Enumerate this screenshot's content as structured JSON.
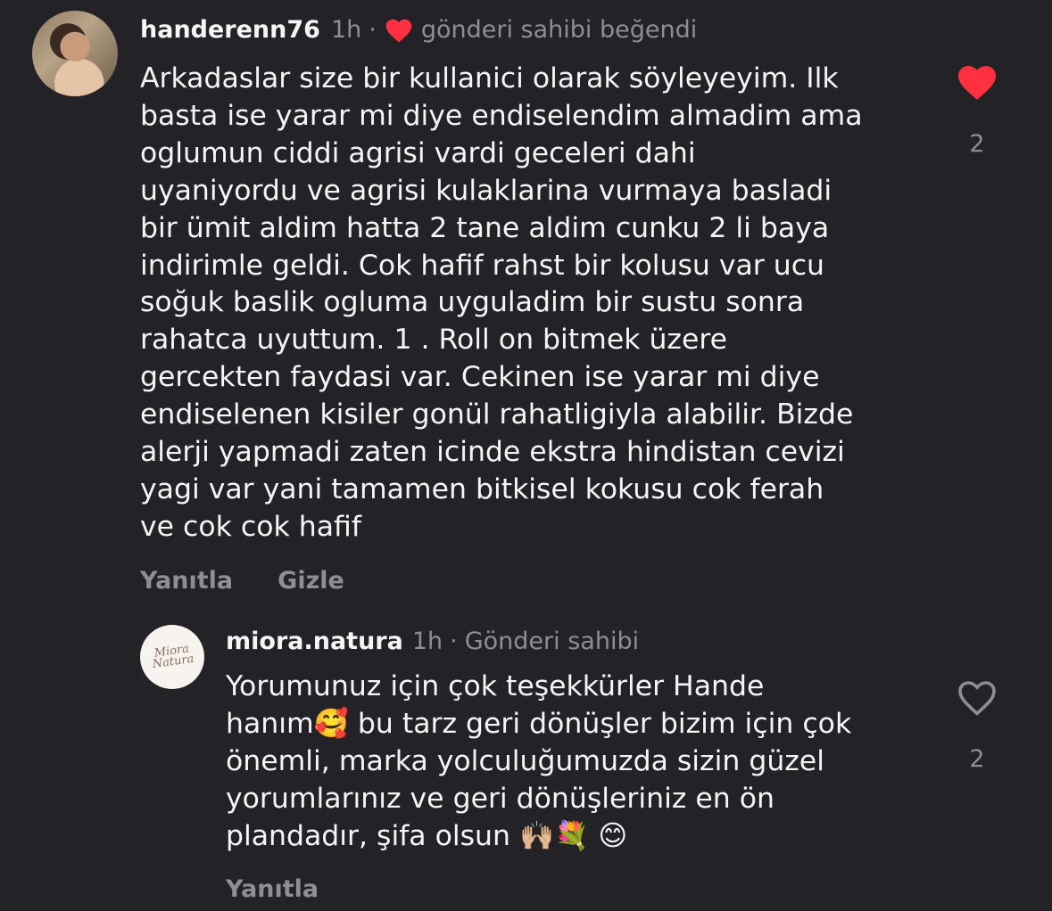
{
  "comments": [
    {
      "username": "handerenn76",
      "time": "1h",
      "author_liked_label": "gönderi sahibi beğendi",
      "lines": [
        "Arkadaslar size bir kullanici olarak söyleyeyim. Ilk",
        "basta ise yarar mi diye endiselendim almadim ama",
        "oglumun ciddi agrisi vardi geceleri dahi",
        "uyaniyordu ve agrisi kulaklarina vurmaya basladi",
        "bir ümit aldim hatta 2 tane aldim cunku 2 li baya",
        "indirimle geldi. Cok hafif rahst bir kolusu var ucu",
        "soğuk baslik ogluma uyguladim bir sustu sonra",
        "rahatca uyuttum. 1 . Roll on bitmek üzere",
        "gercekten faydasi var. Cekinen ise yarar mi diye",
        "endiselenen kisiler gonül rahatligiyla alabilir. Bizde",
        "alerji yapmadi zaten icinde ekstra hindistan cevizi",
        "yagi var yani tamamen bitkisel kokusu cok ferah",
        "ve cok cok hafif"
      ],
      "actions": [
        "Yanıtla",
        "Gizle"
      ],
      "like_count": "2",
      "liked": true
    },
    {
      "username": "miora.natura",
      "time": "1h",
      "badge": "Gönderi sahibi",
      "avatar_text": "Miora Natura",
      "lines": [
        "Yorumunuz için çok teşekkürler Hande",
        "hanım🥰 bu tarz geri dönüşler bizim için çok",
        "önemli, marka yolculuğumuzda sizin güzel",
        "yorumlarınız ve geri dönüşleriniz en ön",
        "plandadır, şifa olsun 🙌🏼💐 😊"
      ],
      "actions": [
        "Yanıtla"
      ],
      "like_count": "2",
      "liked": false
    }
  ],
  "colors": {
    "background": "#222227",
    "text": "#f5f5f5",
    "muted": "#8e8e93",
    "heart_red": "#ff3040"
  }
}
